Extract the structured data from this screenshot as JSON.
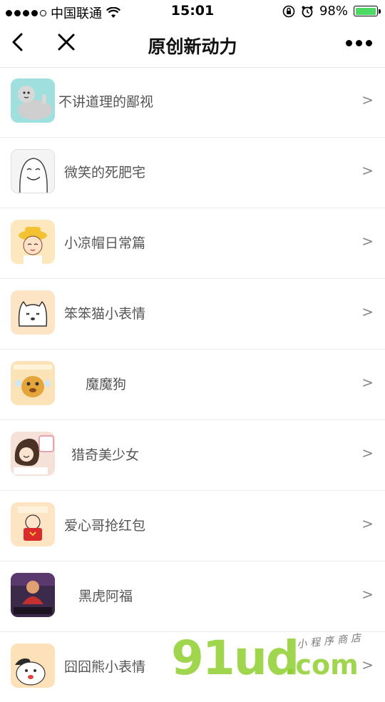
{
  "status_bar": {
    "carrier": "中国联通",
    "time": "15:01",
    "battery": "98%",
    "battery_level": 0.98
  },
  "nav": {
    "title": "原创新动力"
  },
  "items": [
    {
      "label": "不讲道理的鄙视",
      "chevron": ">",
      "color": "#9fe0df"
    },
    {
      "label": "微笑的死肥宅",
      "chevron": ">",
      "color": "#f3f3f3"
    },
    {
      "label": "小凉帽日常篇",
      "chevron": ">",
      "color": "#fde7bf"
    },
    {
      "label": "笨笨猫小表情",
      "chevron": ">",
      "color": "#fde4c4"
    },
    {
      "label": "魔魔狗",
      "chevron": ">",
      "color": "#fbe2b7"
    },
    {
      "label": "猎奇美少女",
      "chevron": ">",
      "color": "#f6e1d9"
    },
    {
      "label": "爱心哥抢红包",
      "chevron": ">",
      "color": "#fde4c2"
    },
    {
      "label": "黑虎阿福",
      "chevron": ">",
      "color": "#3c2a4a"
    },
    {
      "label": "囧囧熊小表情",
      "chevron": ">",
      "color": "#fde2b9"
    }
  ],
  "watermark": {
    "brand": "91ud",
    "domain": ".com",
    "tagline": "小程序商店"
  }
}
